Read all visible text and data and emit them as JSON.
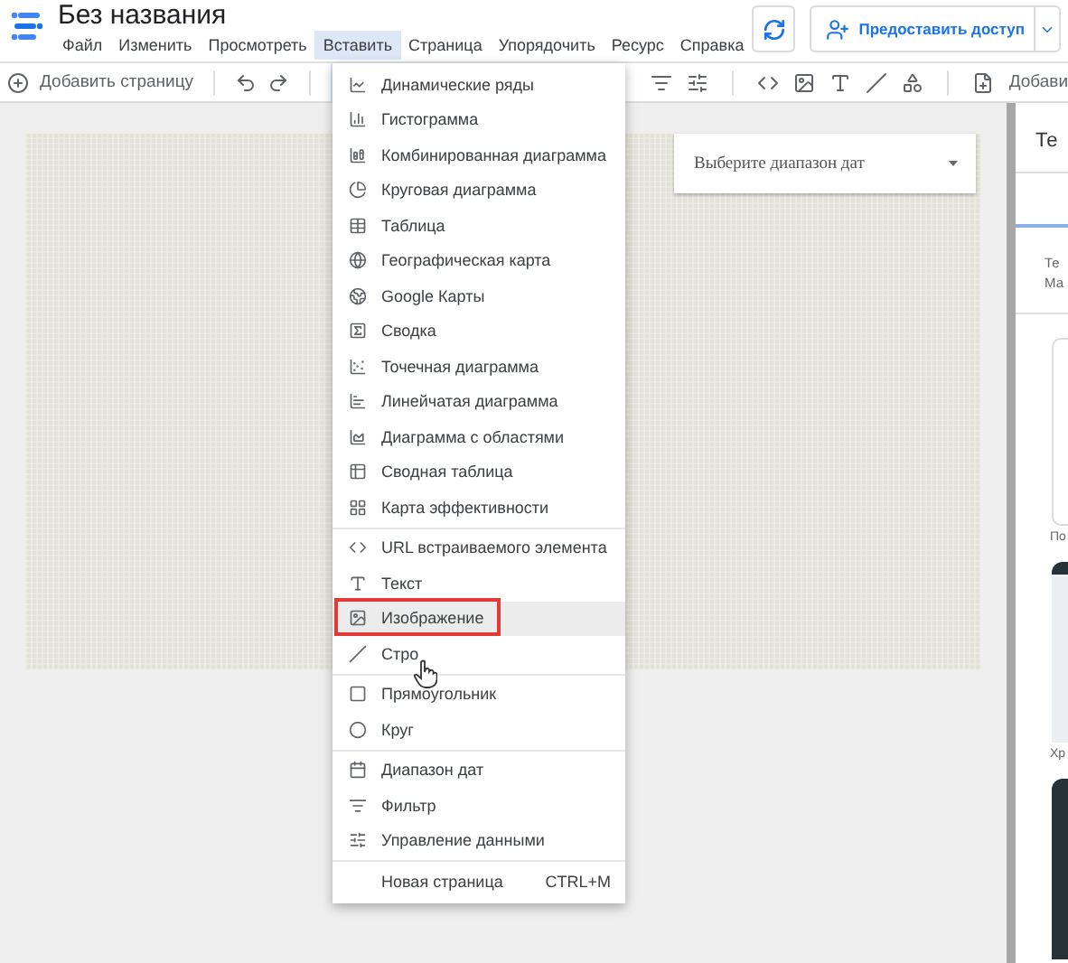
{
  "app": {
    "title": "Без названия"
  },
  "menu_bar": [
    {
      "label": "Файл",
      "selected": false
    },
    {
      "label": "Изменить",
      "selected": false
    },
    {
      "label": "Просмотреть",
      "selected": false
    },
    {
      "label": "Вставить",
      "selected": true
    },
    {
      "label": "Страница",
      "selected": false
    },
    {
      "label": "Упорядочить",
      "selected": false
    },
    {
      "label": "Ресурс",
      "selected": false
    },
    {
      "label": "Справка",
      "selected": false
    }
  ],
  "share_button": "Предоставить доступ",
  "toolbar": {
    "add_page": "Добавить страницу",
    "add_element": "Добави"
  },
  "insert_menu": {
    "groups": [
      [
        {
          "label": "Динамические ряды",
          "highlighted": false
        },
        {
          "label": "Гистограмма",
          "highlighted": false
        },
        {
          "label": "Комбинированная диаграмма",
          "highlighted": false
        },
        {
          "label": "Круговая диаграмма",
          "highlighted": false
        },
        {
          "label": "Таблица",
          "highlighted": false
        },
        {
          "label": "Географическая карта",
          "highlighted": false
        },
        {
          "label": "Google Карты",
          "highlighted": false
        },
        {
          "label": "Сводка",
          "highlighted": false
        },
        {
          "label": "Точечная диаграмма",
          "highlighted": false
        },
        {
          "label": "Линейчатая диаграмма",
          "highlighted": false
        },
        {
          "label": "Диаграмма с областями",
          "highlighted": false
        },
        {
          "label": "Сводная таблица",
          "highlighted": false
        },
        {
          "label": "Карта эффективности",
          "highlighted": false
        }
      ],
      [
        {
          "label": "URL встраиваемого элемента",
          "highlighted": false
        },
        {
          "label": "Текст",
          "highlighted": false
        },
        {
          "label": "Изображение",
          "highlighted": true
        },
        {
          "label": "Стро",
          "highlighted": false
        }
      ],
      [
        {
          "label": "Прямоугольник",
          "highlighted": false
        },
        {
          "label": "Круг",
          "highlighted": false
        }
      ],
      [
        {
          "label": "Диапазон дат",
          "highlighted": false
        },
        {
          "label": "Фильтр",
          "highlighted": false
        },
        {
          "label": "Управление данными",
          "highlighted": false
        }
      ],
      [
        {
          "label": "Новая страница",
          "shortcut": "CTRL+M",
          "highlighted": false
        }
      ]
    ]
  },
  "canvas": {
    "date_picker": {
      "placeholder": "Выберите диапазон дат"
    }
  },
  "side_panel": {
    "heading": "Те",
    "section_lines": [
      "Те",
      "Ма"
    ],
    "card_labels": [
      "По",
      "Хр"
    ]
  }
}
